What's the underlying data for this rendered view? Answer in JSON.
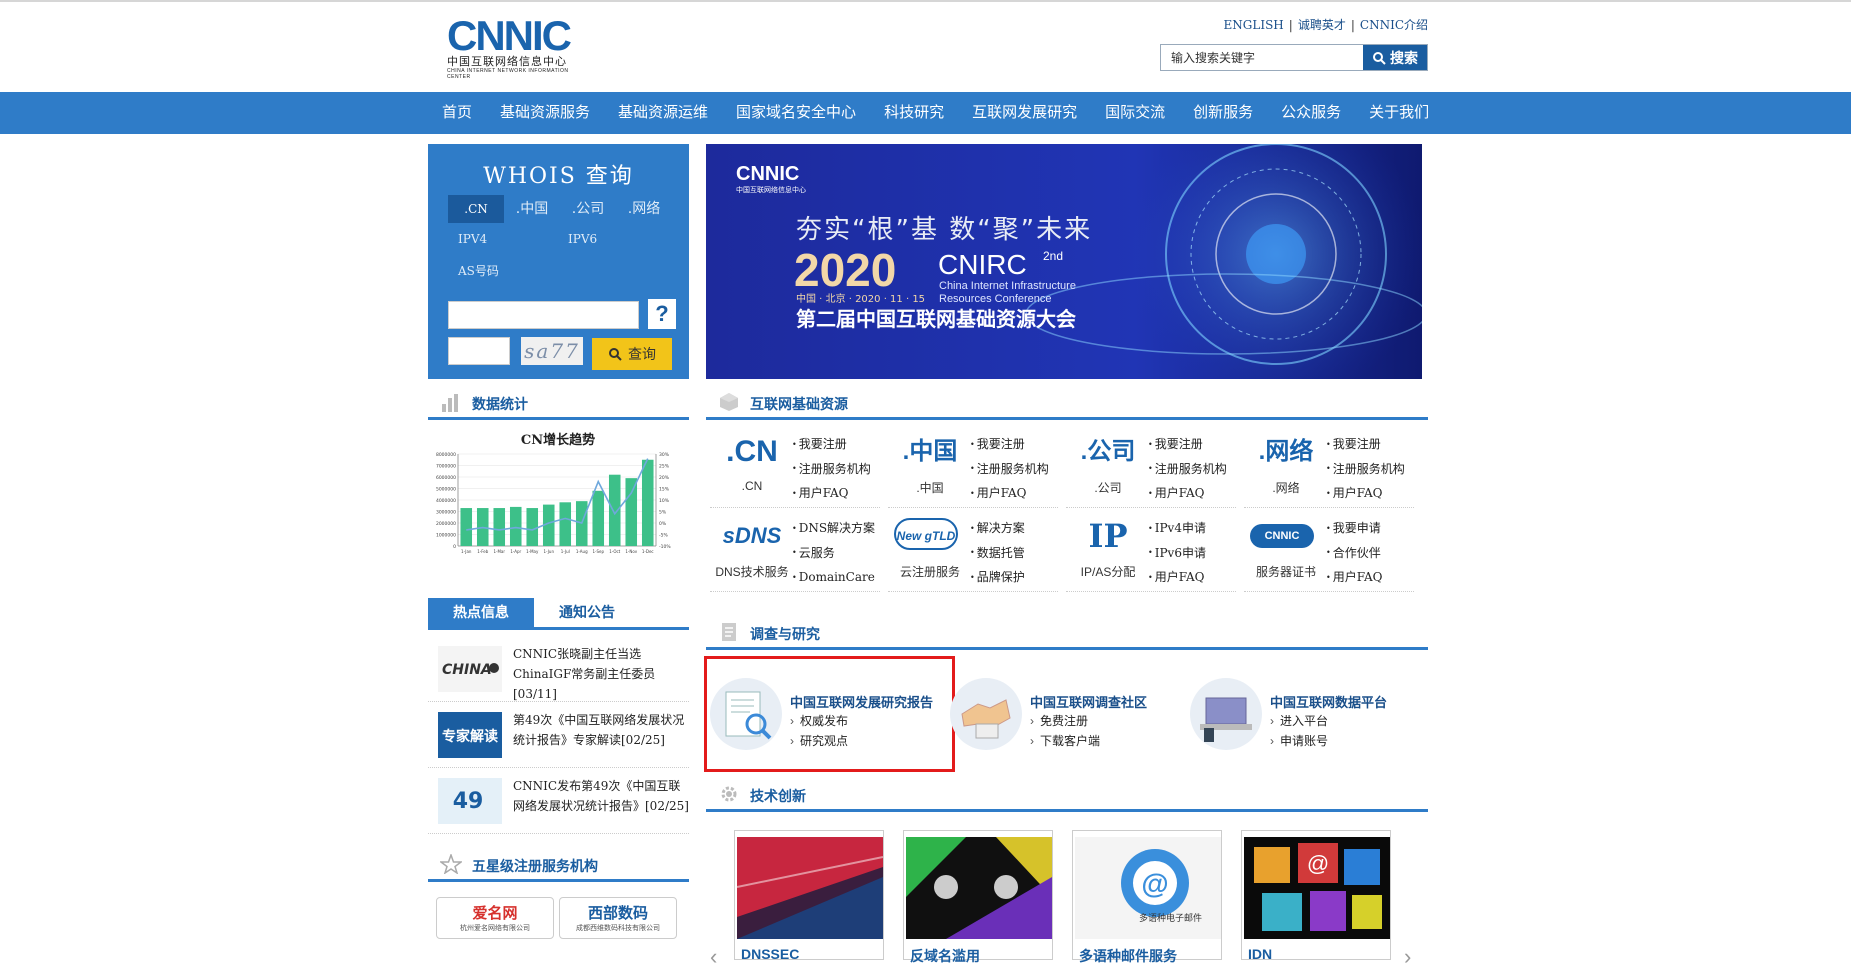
{
  "header": {
    "logo_text": "CNNIC",
    "logo_cn": "中国互联网络信息中心",
    "logo_en": "CHINA INTERNET NETWORK INFORMATION CENTER",
    "top_links": [
      "ENGLISH",
      "诚聘英才",
      "CNNIC介绍"
    ],
    "search_placeholder": "输入搜索关键字",
    "search_button": "搜索"
  },
  "nav": {
    "items": [
      "首页",
      "基础资源服务",
      "基础资源运维",
      "国家域名安全中心",
      "科技研究",
      "互联网发展研究",
      "国际交流",
      "创新服务",
      "公众服务",
      "关于我们"
    ]
  },
  "whois": {
    "title": "WHOIS 查询",
    "tabs": [
      ".CN",
      ".中国",
      ".公司",
      ".网络"
    ],
    "sub_tabs": [
      "IPV4",
      "IPV6",
      "AS号码"
    ],
    "help": "?",
    "captcha": "sa77",
    "query_button": "查询"
  },
  "stats": {
    "section_title": "数据统计",
    "chart_title": "CN增长趋势"
  },
  "chart_data": {
    "type": "bar",
    "title": "CN增长趋势",
    "categories": [
      "1-Jan",
      "1-Feb",
      "1-Mar",
      "1-Apr",
      "1-May",
      "1-Jun",
      "1-Jul",
      "1-Aug",
      "1-Sep",
      "1-Oct",
      "1-Nov",
      "1-Dec"
    ],
    "series": [
      {
        "type": "bar",
        "values": [
          3300000,
          3300000,
          3300000,
          3400000,
          3300000,
          3600000,
          3800000,
          3900000,
          4800000,
          6200000,
          5900000,
          7500000
        ]
      },
      {
        "type": "line",
        "values": [
          -3,
          -2,
          -3,
          -2,
          -3,
          0,
          2,
          0,
          18,
          4,
          13,
          28
        ]
      }
    ],
    "ylim": [
      0,
      8000000
    ],
    "y2lim": [
      -10,
      30
    ],
    "yticks": [
      "8000000",
      "7000000",
      "6000000",
      "5000000",
      "4000000",
      "3000000",
      "2000000",
      "1000000",
      "0"
    ],
    "y2ticks": [
      "30%",
      "25%",
      "20%",
      "15%",
      "10%",
      "5%",
      "0%",
      "-5%",
      "-10%"
    ]
  },
  "news": {
    "tab_active": "热点信息",
    "tab_inactive": "通知公告",
    "items": [
      {
        "text": "CNNIC张晓副主任当选ChinaIGF常务副主任委员[03/11]",
        "thumb": "CHINA"
      },
      {
        "text": "第49次《中国互联网络发展状况统计报告》专家解读[02/25]",
        "thumb": "专家解读"
      },
      {
        "text": "CNNIC发布第49次《中国互联网络发展状况统计报告》[02/25]",
        "thumb": "49"
      }
    ]
  },
  "partners": {
    "section_title": "五星级注册服务机构",
    "items": [
      {
        "name": "爱名网",
        "sub": "杭州爱名网络有限公司"
      },
      {
        "name": "西部数码",
        "sub": "成都西维数码科技有限公司"
      }
    ]
  },
  "banner": {
    "logo1": "CNNIC",
    "logo1_sub": "中国互联网络信息中心",
    "slogan": "夯实“根”基   数“聚”未来",
    "year": "2020",
    "name": "CNIRC",
    "edition": "2nd",
    "en1": "China Internet Infrastructure",
    "en2": "Resources Conference",
    "date": "中国 · 北京 · 2020 · 11 · 15",
    "cn_title": "第二届中国互联网基础资源大会"
  },
  "resources": {
    "section_title": "互联网基础资源",
    "cells": [
      {
        "logo": ".CN",
        "caption": ".CN",
        "links": [
          "我要注册",
          "注册服务机构",
          "用户FAQ"
        ]
      },
      {
        "logo": ".中国",
        "caption": ".中国",
        "links": [
          "我要注册",
          "注册服务机构",
          "用户FAQ"
        ]
      },
      {
        "logo": ".公司",
        "caption": ".公司",
        "links": [
          "我要注册",
          "注册服务机构",
          "用户FAQ"
        ]
      },
      {
        "logo": ".网络",
        "caption": ".网络",
        "links": [
          "我要注册",
          "注册服务机构",
          "用户FAQ"
        ]
      },
      {
        "logo": "sDNS",
        "caption": "DNS技术服务",
        "links": [
          "DNS解决方案",
          "云服务",
          "DomainCare"
        ]
      },
      {
        "logo": "New gTLD",
        "caption": "云注册服务",
        "links": [
          "解决方案",
          "数据托管",
          "品牌保护"
        ]
      },
      {
        "logo": "IP",
        "caption": "IP/AS分配",
        "links": [
          "IPv4申请",
          "IPv6申请",
          "用户FAQ"
        ]
      },
      {
        "logo": "CNNIC",
        "caption": "服务器证书",
        "links": [
          "我要申请",
          "合作伙伴",
          "用户FAQ"
        ]
      }
    ]
  },
  "research": {
    "section_title": "调查与研究",
    "items": [
      {
        "title": "中国互联网发展研究报告",
        "links": [
          "权威发布",
          "研究观点"
        ]
      },
      {
        "title": "中国互联网调查社区",
        "links": [
          "免费注册",
          "下载客户端"
        ]
      },
      {
        "title": "中国互联网数据平台",
        "links": [
          "进入平台",
          "申请账号"
        ]
      }
    ]
  },
  "tech": {
    "section_title": "技术创新",
    "items": [
      "DNSSEC",
      "反域名滥用",
      "多语种邮件服务",
      "IDN"
    ],
    "badge": "多语种电子邮件"
  },
  "colors": {
    "primary": "#2f7cc8",
    "dark_blue": "#1a5da0",
    "highlight": "#e31b1b",
    "yellow": "#f2c419",
    "chart_green": "#3dc089",
    "chart_line": "#6fa8dc"
  }
}
